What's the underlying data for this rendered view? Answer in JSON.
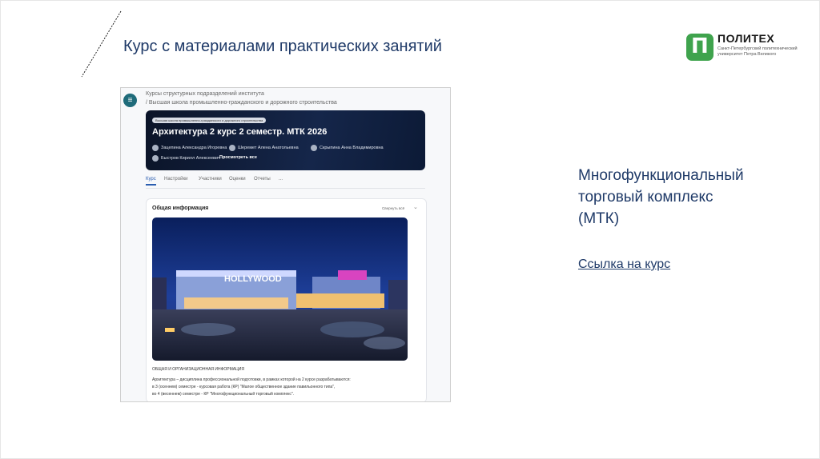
{
  "slide": {
    "title": "Курс с материалами практических занятий",
    "right_title_line1": "Многофункциональный",
    "right_title_line2": "торговый комплекс",
    "right_title_line3": "(МТК)",
    "course_link": "Ссылка на курс"
  },
  "logo": {
    "name": "ПОЛИТЕХ",
    "subtitle": "Санкт-Петербургский политехнический университет Петра Великого",
    "glyph": "П"
  },
  "screenshot": {
    "menu_icon": "≡",
    "breadcrumb_line1": "Курсы структурных подразделений института",
    "breadcrumb_line2": "/ Высшая школа промышленно-гражданского и дорожного строительства",
    "banner": {
      "chip": "Высшая школа промышленно-гражданского и дорожного строительства",
      "title": "Архитектура 2 курс 2 семестр. МТК 2026",
      "teachers": [
        "Зацепина Александра Игоревна",
        "Шеремет Алена Анатольевна",
        "Скрыпина Анна Владимировна",
        "Быстров Кирилл Алексеевич"
      ],
      "view_all": "Просмотреть все"
    },
    "tabs": [
      "Курс",
      "Настройки",
      "Участники",
      "Оценки",
      "Отчеты",
      "..."
    ],
    "card": {
      "heading": "Общая информация",
      "collapse_all": "Свернуть всё",
      "photo_sign": "HOLLYWOOD",
      "org_heading": "ОБЩАЯ И ОРГАНИЗАЦИОННАЯ ИНФОРМАЦИЯ",
      "desc_line1": "Архитектура – дисциплина профессиональной подготовки, в рамках которой на 2 курсе разрабатываются:",
      "desc_line2": "в 3 (осеннем) семестре - курсовая работа (КР) \"Малое общественное здание павильонного типа\",",
      "desc_line3": "во 4 (весеннем) семестре - КР \"Многофункциональный торговый комплекс\"."
    }
  },
  "colors": {
    "title": "#1f3a68",
    "logo_green": "#3fa34d",
    "banner_bg": "#0b1428",
    "active_tab": "#2a5db0"
  }
}
